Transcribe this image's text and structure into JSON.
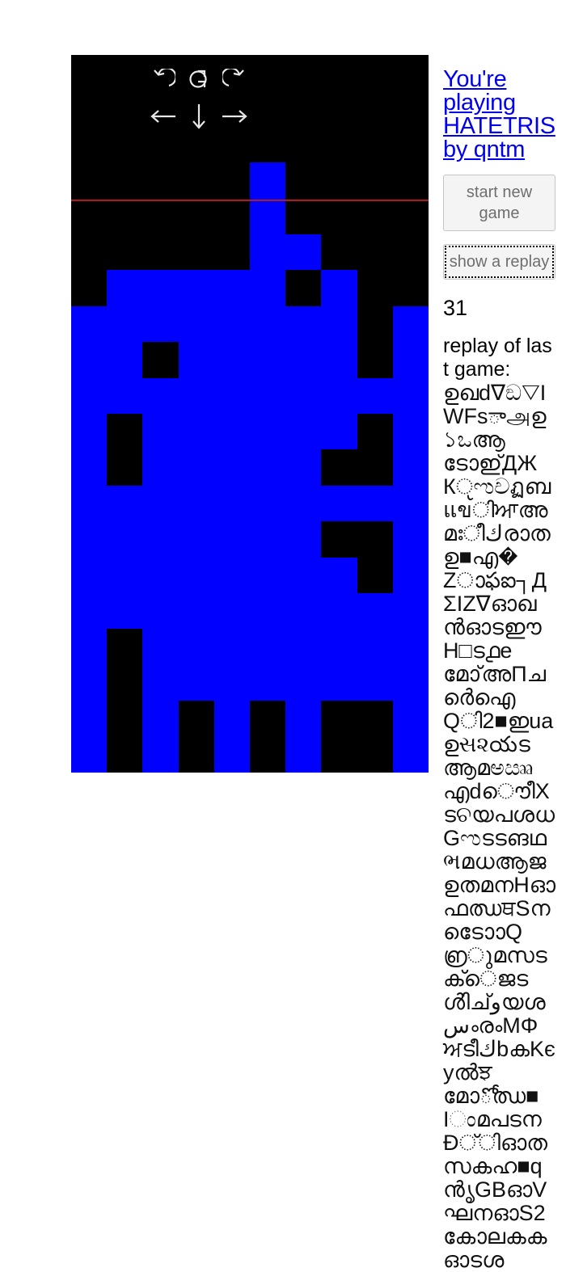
{
  "page": {
    "background": "#ffffff",
    "board_bg": "#000000",
    "block_color": "#0000ff",
    "link_color": "#0000ee",
    "bar_color": "#c02020"
  },
  "controls": {
    "items": [
      {
        "name": "rotate-counterclockwise-icon",
        "label": "rotate left"
      },
      {
        "name": "reset-rotation-icon",
        "label": "rotate 180"
      },
      {
        "name": "rotate-clockwise-icon",
        "label": "rotate right"
      },
      {
        "name": "move-left-icon",
        "label": "move left"
      },
      {
        "name": "move-down-icon",
        "label": "move down"
      },
      {
        "name": "move-right-icon",
        "label": "move right"
      }
    ]
  },
  "sidebar": {
    "title": "You're playing HATETRIS by qntm",
    "start_new_game_label": "start new game",
    "show_replay_label": "show a replay",
    "score": "31",
    "replay_label": "replay of last game:",
    "replay_string": "ഉഖd∇ඞ▽IWFsాஅഉ১ಒആടോഇ്ДЖКੵಌචฏബแขിਆഅമഃീكരാതഉ■എ�Zാఫఐ┐ДΣIZ∇ഓഖൻഓടഈH□ട൧eമോ്അПചർെഐQി2■ഇuaഉસ૨యടആമಅඎഎdൌീXടଚയപശധGಌടടങഥભമധആജഉതമനHഓഫഝਥSനടോൊQ൏ുമസടക്െജടൾിച്وയശسൟМΦਅടീكbകKєyൽਝമോోഝ■IಂമപടനĐ്ിഓതസകഹ■qൻൃGBഓVഘനഓS2കോലകകഓടശ"
  }
}
